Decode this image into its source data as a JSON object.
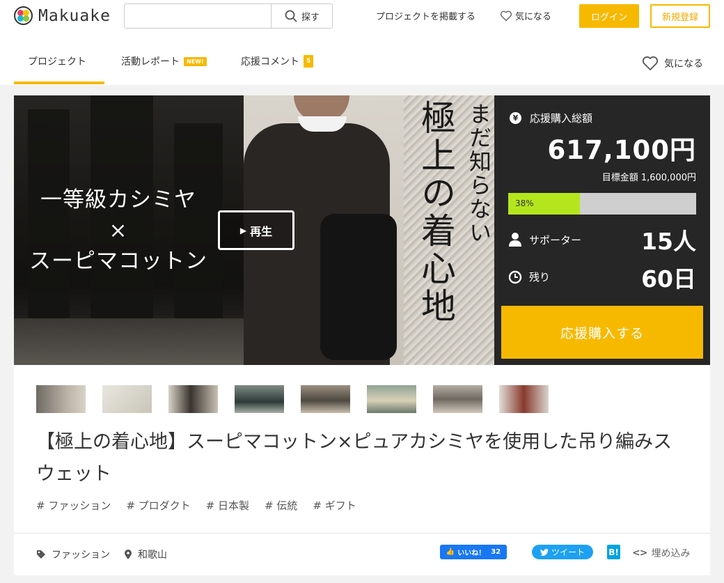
{
  "header": {
    "logo_text": "Makuake",
    "search": {
      "placeholder": "",
      "button_label": "探す"
    },
    "links": {
      "post_project": "プロジェクトを掲載する",
      "favorite": "気になる"
    },
    "login_label": "ログイン",
    "signup_label": "新規登録"
  },
  "tabs": {
    "project": "プロジェクト",
    "activity": "活動レポート",
    "activity_badge": "NEW!",
    "comments": "応援コメント",
    "comments_badge": "5",
    "favorite": "気になる"
  },
  "hero": {
    "copy_line1": "一等級カシミヤ",
    "copy_line2": "×",
    "copy_line3": "スーピマコットン",
    "play_label": "再生",
    "vertical_small": "まだ知らない",
    "vertical_large": "極上の着心地"
  },
  "funding": {
    "label": "応援購入総額",
    "amount": "617,100円",
    "goal": "目標金額 1,600,000円",
    "progress_percent": 38,
    "progress_text": "38%",
    "supporters_label": "サポーター",
    "supporters_value": "15人",
    "remaining_label": "残り",
    "remaining_value": "60日",
    "cta_label": "応援購入する",
    "accent_color": "#f7b900",
    "progress_color": "#b5e61d"
  },
  "project": {
    "title": "【極上の着心地】スーピマコットン×ピュアカシミヤを使用した吊り編みスウェット",
    "tags": [
      "# ファッション",
      "# プロダクト",
      "# 日本製",
      "# 伝統",
      "# ギフト"
    ],
    "category": "ファッション",
    "location": "和歌山"
  },
  "share": {
    "like_label": "いいね！",
    "like_count": "32",
    "tweet_label": "ツイート",
    "hatena_label": "B!",
    "embed_label": "埋め込み"
  }
}
